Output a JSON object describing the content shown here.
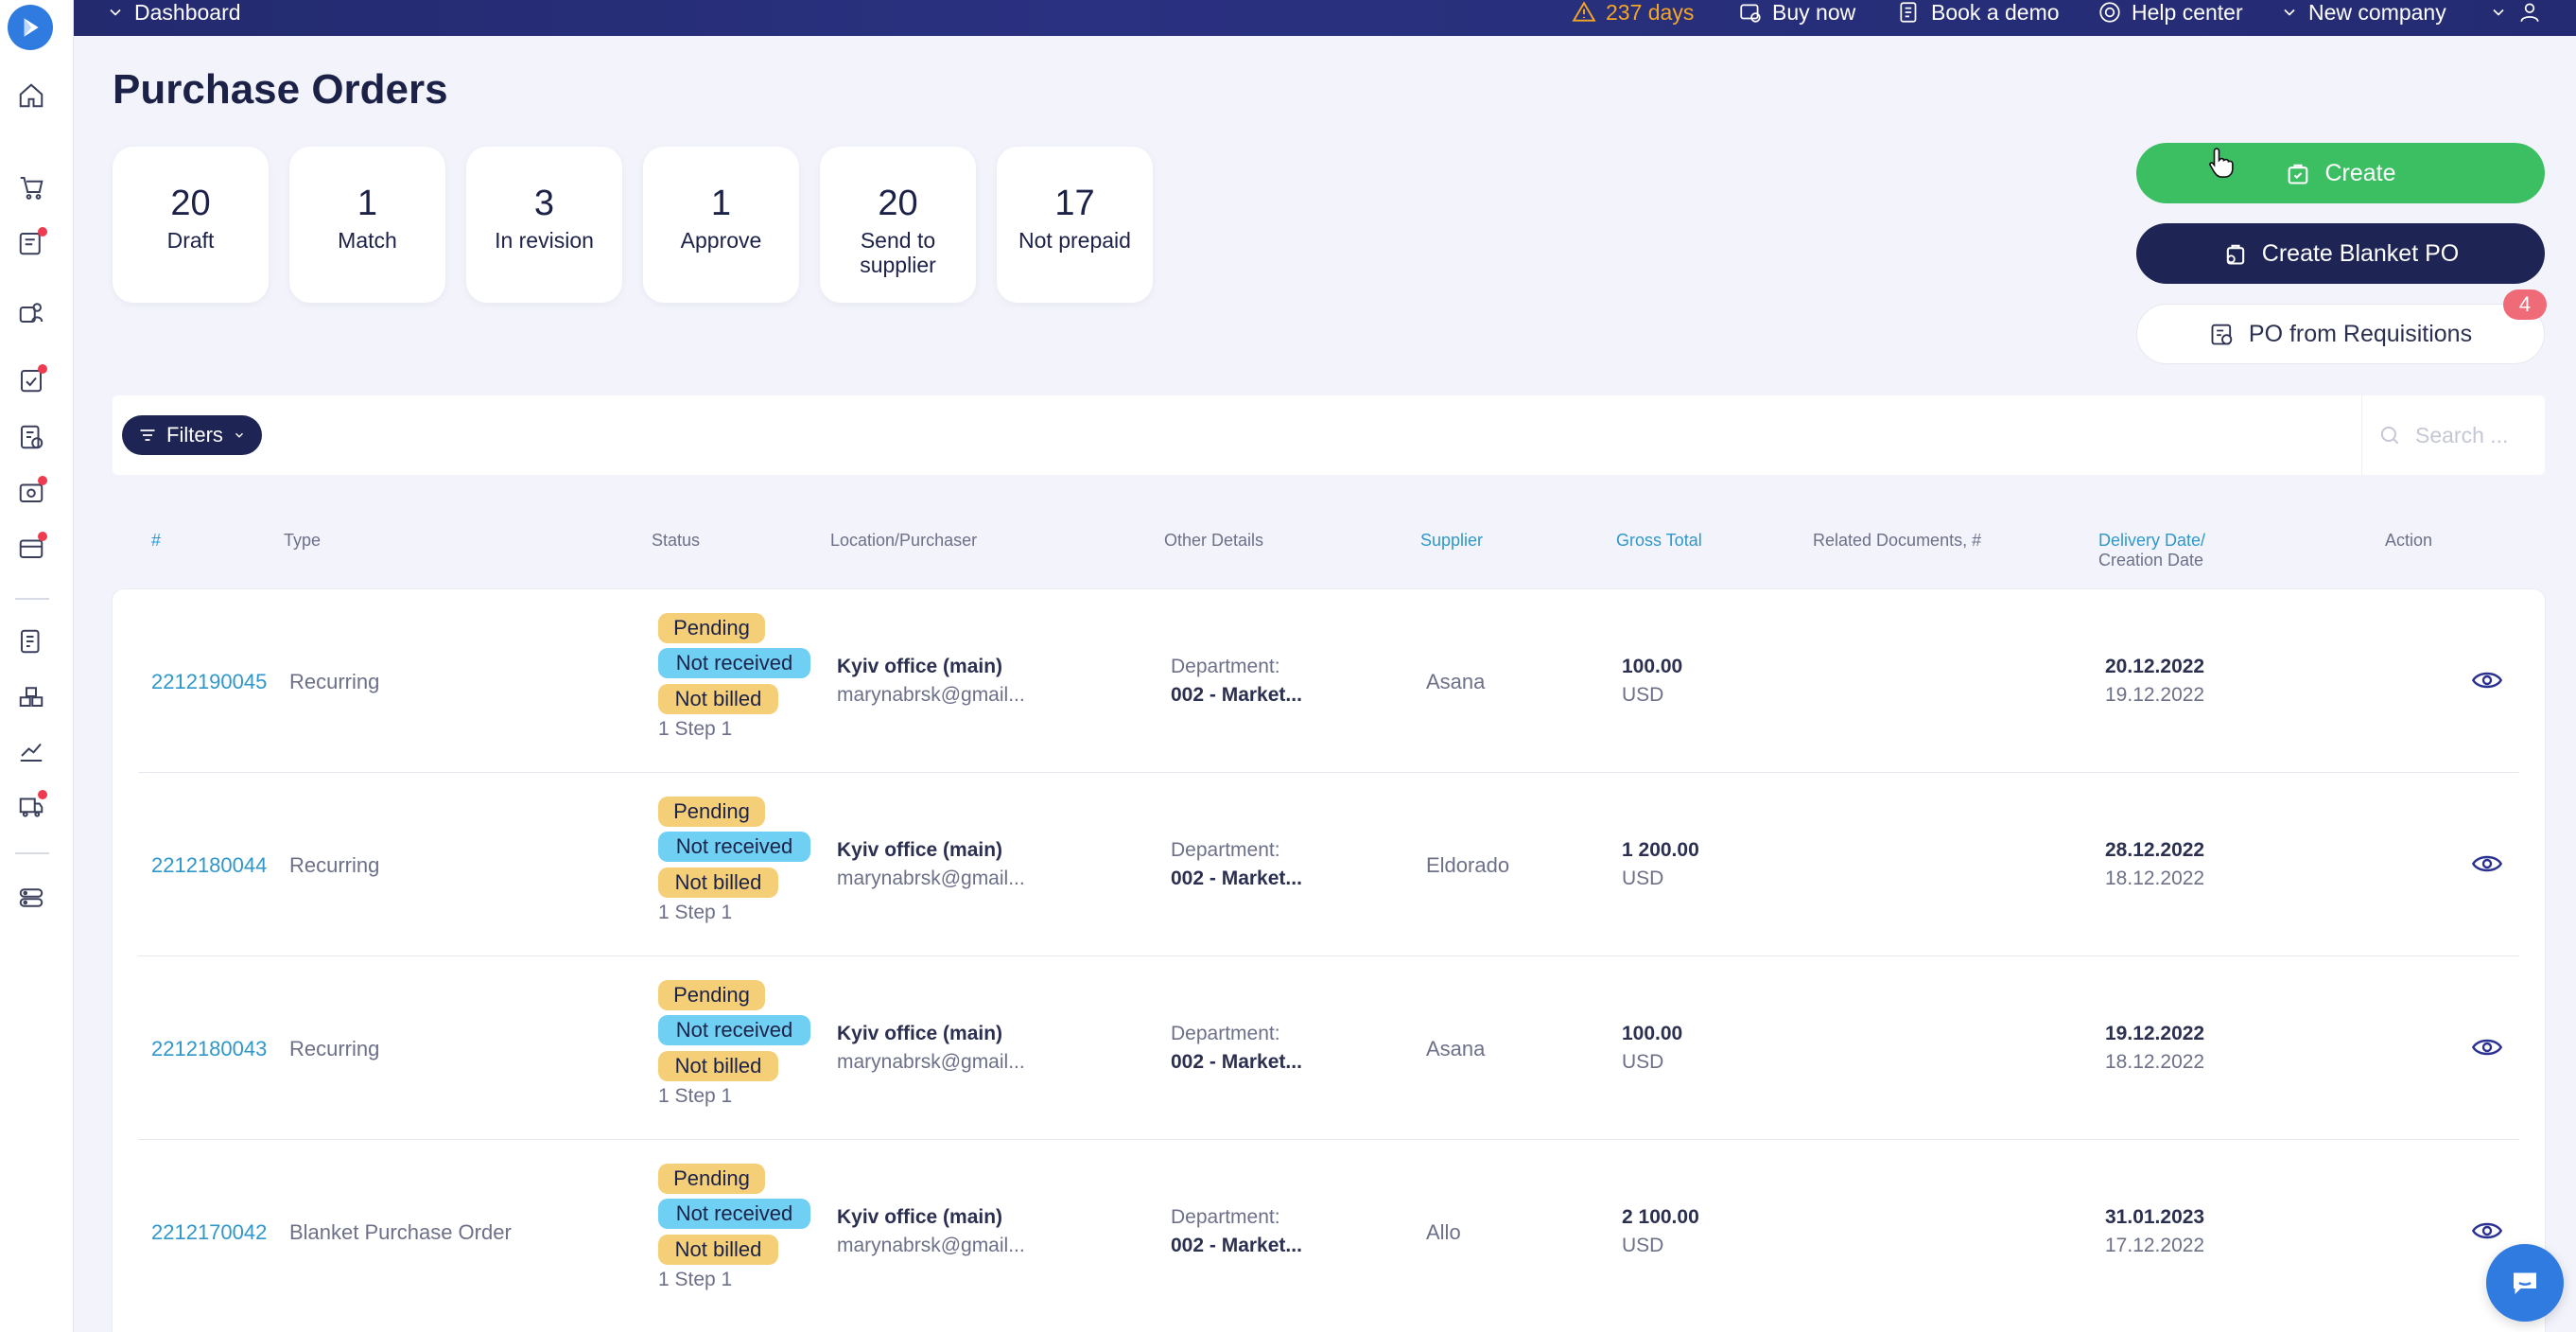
{
  "topbar": {
    "nav_label": "Dashboard",
    "trial_days": "237 days",
    "buy_now": "Buy now",
    "book_demo": "Book a demo",
    "help_center": "Help center",
    "company": "New company"
  },
  "page": {
    "title": "Purchase Orders"
  },
  "stats": [
    {
      "value": "20",
      "label": "Draft"
    },
    {
      "value": "1",
      "label": "Match"
    },
    {
      "value": "3",
      "label": "In revision"
    },
    {
      "value": "1",
      "label": "Approve"
    },
    {
      "value": "20",
      "label": "Send to supplier"
    },
    {
      "value": "17",
      "label": "Not prepaid"
    }
  ],
  "actions": {
    "create": "Create",
    "create_blanket": "Create Blanket PO",
    "from_requisitions": "PO from Requisitions",
    "requisitions_count": "4"
  },
  "filters": {
    "label": "Filters",
    "search_placeholder": "Search ..."
  },
  "table": {
    "headers": {
      "id": "#",
      "type": "Type",
      "status": "Status",
      "location": "Location/Purchaser",
      "other": "Other Details",
      "supplier": "Supplier",
      "gross": "Gross Total",
      "related": "Related Documents, #",
      "delivery_line1": "Delivery Date/",
      "delivery_line2": "Creation Date",
      "action": "Action"
    },
    "rows": [
      {
        "id": "2212190045",
        "type": "Recurring",
        "status": [
          "Pending",
          "Not received",
          "Not billed"
        ],
        "step": "1 Step 1",
        "location": "Kyiv office (main)",
        "purchaser": "marynabrsk@gmail...",
        "dept_label": "Department:",
        "dept_value": "002 - Market...",
        "supplier": "Asana",
        "amount": "100.00",
        "currency": "USD",
        "delivery": "20.12.2022",
        "created": "19.12.2022"
      },
      {
        "id": "2212180044",
        "type": "Recurring",
        "status": [
          "Pending",
          "Not received",
          "Not billed"
        ],
        "step": "1 Step 1",
        "location": "Kyiv office (main)",
        "purchaser": "marynabrsk@gmail...",
        "dept_label": "Department:",
        "dept_value": "002 - Market...",
        "supplier": "Eldorado",
        "amount": "1 200.00",
        "currency": "USD",
        "delivery": "28.12.2022",
        "created": "18.12.2022"
      },
      {
        "id": "2212180043",
        "type": "Recurring",
        "status": [
          "Pending",
          "Not received",
          "Not billed"
        ],
        "step": "1 Step 1",
        "location": "Kyiv office (main)",
        "purchaser": "marynabrsk@gmail...",
        "dept_label": "Department:",
        "dept_value": "002 - Market...",
        "supplier": "Asana",
        "amount": "100.00",
        "currency": "USD",
        "delivery": "19.12.2022",
        "created": "18.12.2022"
      },
      {
        "id": "2212170042",
        "type": "Blanket Purchase Order",
        "status": [
          "Pending",
          "Not received",
          "Not billed"
        ],
        "step": "1 Step 1",
        "location": "Kyiv office (main)",
        "purchaser": "marynabrsk@gmail...",
        "dept_label": "Department:",
        "dept_value": "002 - Market...",
        "supplier": "Allo",
        "amount": "2 100.00",
        "currency": "USD",
        "delivery": "31.01.2023",
        "created": "17.12.2022"
      }
    ]
  },
  "colors": {
    "primary_navy": "#1e2453",
    "create_green": "#3cbf63",
    "link_blue": "#2f97c9",
    "pending_yellow": "#f5cf78",
    "not_received_blue": "#6fd0f3",
    "alert_red": "#ef3b4f",
    "warning_orange": "#f5a623"
  }
}
